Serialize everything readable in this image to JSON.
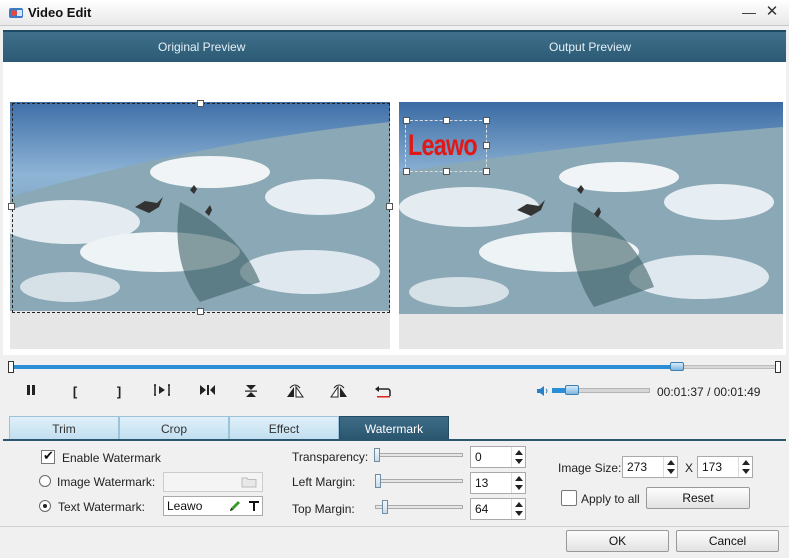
{
  "window": {
    "title": "Video Edit",
    "minimize": "—",
    "close": "✕"
  },
  "preview": {
    "original_label": "Original Preview",
    "output_label": "Output Preview"
  },
  "watermark_preview_text": "Leawo",
  "playback": {
    "progress_fraction": 0.87,
    "current_time": "00:01:37",
    "separator": "/",
    "total_time": "00:01:49",
    "volume_fraction": 0.2,
    "controls": [
      "play-pause",
      "mark-in",
      "mark-out",
      "step-frame",
      "to-end",
      "flip-vertical",
      "flip-horizontal-left",
      "flip-horizontal-right",
      "rotate-undo"
    ],
    "mark_in_glyph": "[",
    "mark_out_glyph": "]"
  },
  "tabs": [
    {
      "label": "Trim",
      "active": false
    },
    {
      "label": "Crop",
      "active": false
    },
    {
      "label": "Effect",
      "active": false
    },
    {
      "label": "Watermark",
      "active": true
    }
  ],
  "watermark": {
    "enable_label": "Enable Watermark",
    "enable_checked": true,
    "image_label": "Image Watermark:",
    "image_value": "",
    "text_label": "Text Watermark:",
    "text_value": "Leawo",
    "text_selected": true,
    "transparency_label": "Transparency:",
    "transparency_value": "0",
    "left_margin_label": "Left Margin:",
    "left_margin_value": "13",
    "top_margin_label": "Top  Margin:",
    "top_margin_value": "64",
    "image_size_label": "Image Size:",
    "image_width": "273",
    "size_x": "X",
    "image_height": "173",
    "apply_all_label": "Apply to all",
    "apply_all_checked": false,
    "reset_label": "Reset"
  },
  "footer": {
    "ok_label": "OK",
    "cancel_label": "Cancel"
  },
  "colors": {
    "header_blue": "#2c5a75",
    "accent_blue": "#2b8fd6",
    "watermark_red": "#e01818"
  }
}
